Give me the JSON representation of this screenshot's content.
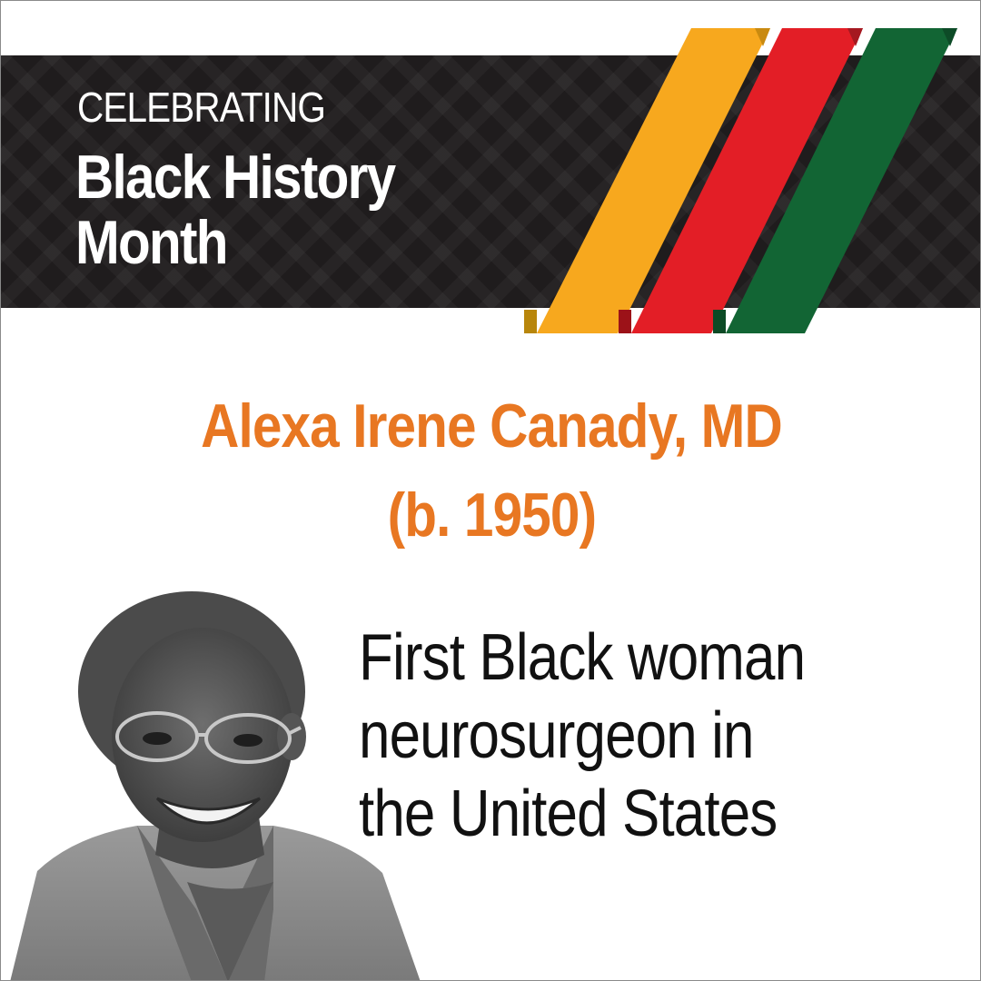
{
  "banner": {
    "kicker": "CELEBRATING",
    "headline_line1": "Black History",
    "headline_line2": "Month"
  },
  "colors": {
    "banner_bg": "#1f1c1d",
    "stripe_yellow": "#f7a81e",
    "stripe_red": "#e31e26",
    "stripe_green": "#126534",
    "name_orange": "#e87722"
  },
  "honoree": {
    "name": "Alexa Irene Canady, MD",
    "years": "(b. 1950)",
    "fact_line1": "First Black woman",
    "fact_line2": "neurosurgeon in",
    "fact_line3": "the United States"
  },
  "portrait": {
    "icon": "person-portrait-icon"
  }
}
